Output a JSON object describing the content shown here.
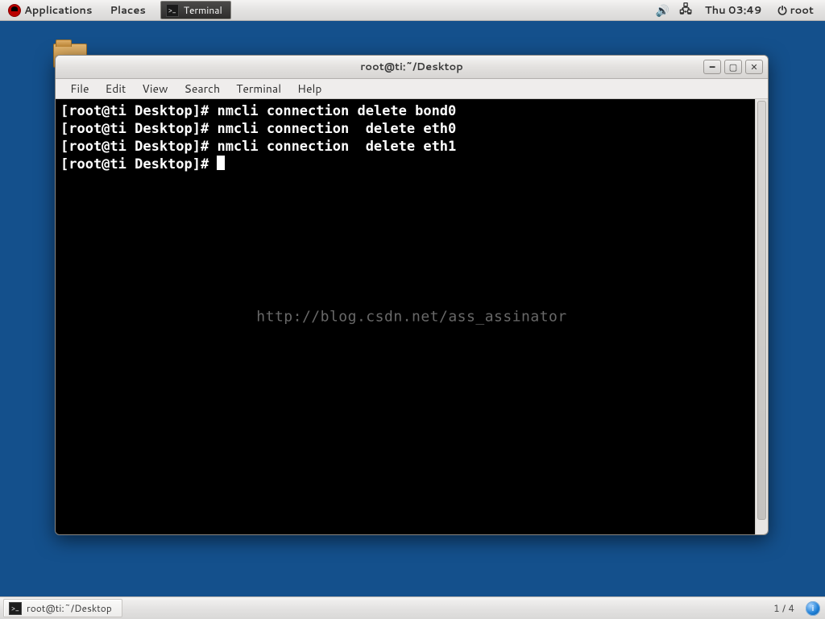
{
  "top_panel": {
    "applications": "Applications",
    "places": "Places",
    "task_label": "Terminal",
    "clock": "Thu 03:49",
    "user": "root"
  },
  "window": {
    "title": "root@ti:~/Desktop",
    "menus": {
      "file": "File",
      "edit": "Edit",
      "view": "View",
      "search": "Search",
      "terminal": "Terminal",
      "help": "Help"
    }
  },
  "terminal": {
    "prompt": "[root@ti Desktop]#",
    "lines": [
      "[root@ti Desktop]# nmcli connection delete bond0",
      "[root@ti Desktop]# nmcli connection  delete eth0",
      "[root@ti Desktop]# nmcli connection  delete eth1"
    ],
    "watermark": "http://blog.csdn.net/ass_assinator"
  },
  "bottom_panel": {
    "task_label": "root@ti:~/Desktop",
    "workspace": "1 / 4"
  }
}
